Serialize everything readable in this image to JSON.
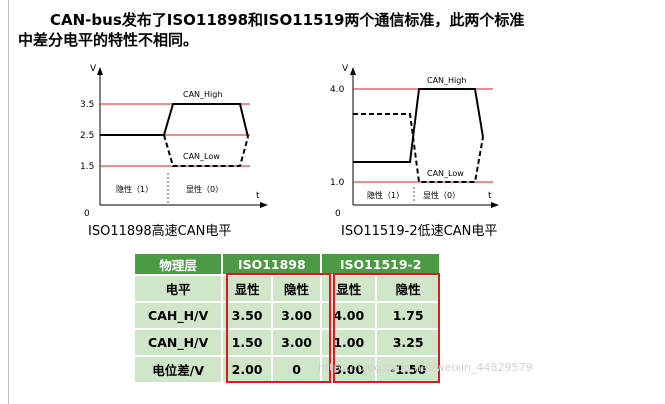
{
  "heading": {
    "line1": "CAN-bus发布了ISO11898和ISO11519两个通信标准，此两个标准",
    "line2": "中差分电平的特性不相同。"
  },
  "diagram_left": {
    "caption": "ISO11898高速CAN电平",
    "axis_v": "V",
    "axis_t": "t",
    "origin": "0",
    "ticks": [
      "3.5",
      "2.5",
      "1.5"
    ],
    "label_high": "CAN_High",
    "label_low": "CAN_Low",
    "recessive": "隐性（1）",
    "dominant": "显性（0）"
  },
  "diagram_right": {
    "caption": "ISO11519-2低速CAN电平",
    "axis_v": "V",
    "axis_t": "t",
    "origin": "0",
    "ticks": [
      "4.0",
      "1.0"
    ],
    "label_high": "CAN_High",
    "label_low": "CAN_Low",
    "recessive": "隐性（1）",
    "dominant": "显性（0）"
  },
  "table": {
    "header_row": [
      "物理层",
      "ISO11898",
      "ISO11519-2"
    ],
    "sub_header": [
      "电平",
      "显性",
      "隐性",
      "显性",
      "隐性"
    ],
    "rows": [
      [
        "CAH_H/V",
        "3.50",
        "3.00",
        "4.00",
        "1.75"
      ],
      [
        "CAN_H/V",
        "1.50",
        "3.00",
        "1.00",
        "3.25"
      ],
      [
        "电位差/V",
        "2.00",
        "0",
        "3.00",
        "-1.50"
      ]
    ]
  },
  "watermark": "https://blog.csdn.net/weixin_44829579",
  "colors": {
    "table_header_bg": "#4c9a45",
    "table_cell_bg": "#cfe6c8",
    "highlight_box": "#e0191c",
    "signal_line": "#000000",
    "reference_line": "#e0191c"
  }
}
